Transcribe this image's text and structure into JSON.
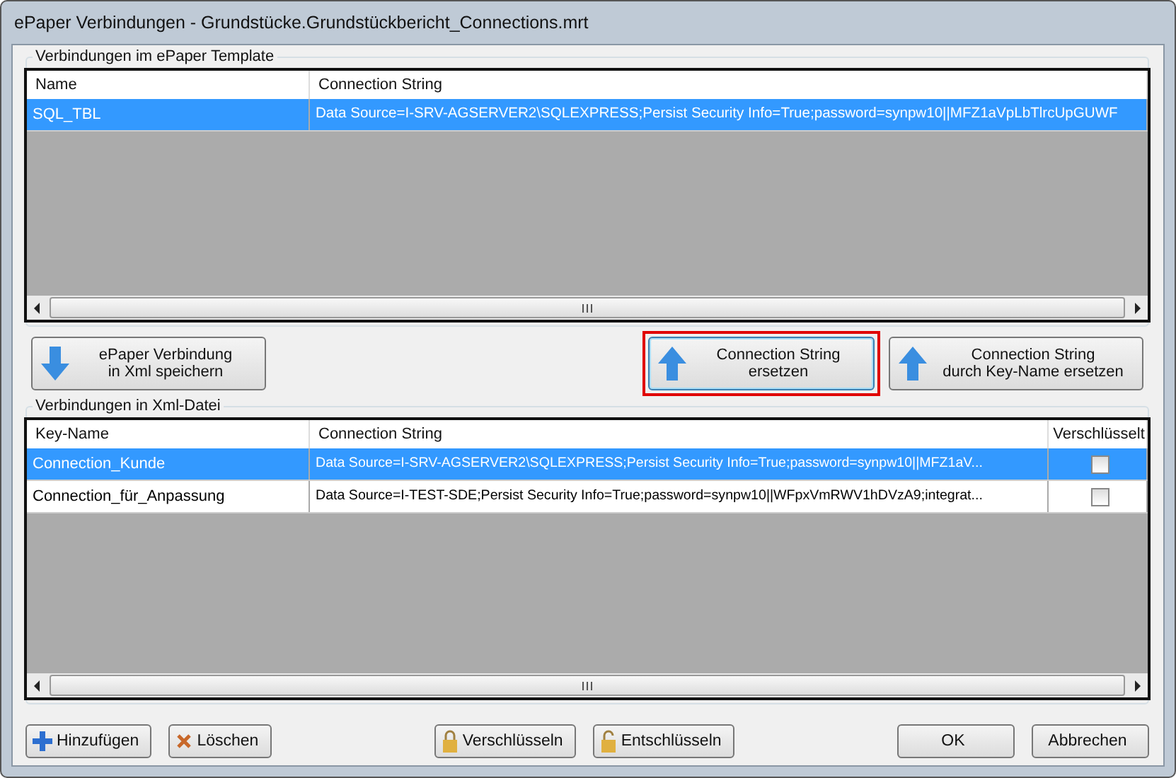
{
  "window": {
    "title": "ePaper Verbindungen - Grundstücke.Grundstückbericht_Connections.mrt"
  },
  "template_group": {
    "label": "Verbindungen im ePaper Template",
    "columns": [
      "Name",
      "Connection String"
    ],
    "rows": [
      {
        "selected": true,
        "cells": [
          "SQL_TBL",
          "Data Source=I-SRV-AGSERVER2\\SQLEXPRESS;Persist Security Info=True;password=synpw10||MFZ1aVpLbTlrcUpGUWF"
        ]
      }
    ]
  },
  "middle_buttons": [
    {
      "label": "ePaper Verbindung\nin Xml speichern",
      "kind": "down",
      "highlighted": false
    },
    {
      "label": "Connection String\nersetzen",
      "kind": "up",
      "highlighted": true
    },
    {
      "label": "Connection String\ndurch Key-Name ersetzen",
      "kind": "up",
      "highlighted": false
    }
  ],
  "xml_group": {
    "label": "Verbindungen in Xml-Datei",
    "columns": [
      "Key-Name",
      "Connection String",
      "Verschlüsselt"
    ],
    "rows": [
      {
        "selected": true,
        "checked": false,
        "cells": [
          "Connection_Kunde",
          "Data Source=I-SRV-AGSERVER2\\SQLEXPRESS;Persist Security Info=True;password=synpw10||MFZ1aV..."
        ]
      },
      {
        "selected": false,
        "checked": false,
        "cells": [
          "Connection_für_Anpassung",
          "Data Source=I-TEST-SDE;Persist Security Info=True;password=synpw10||WFpxVmRWV1hDVzA9;integrat..."
        ]
      }
    ]
  },
  "bottom_buttons": [
    {
      "label": "Hinzufügen",
      "kind": "add"
    },
    {
      "label": "Löschen",
      "kind": "delete"
    },
    {
      "label": "Verschlüsseln",
      "kind": "encrypt"
    },
    {
      "label": "Entschlüsseln",
      "kind": "decrypt"
    },
    {
      "label": "OK",
      "kind": "confirm"
    },
    {
      "label": "Abbrechen",
      "kind": "cancel"
    }
  ]
}
